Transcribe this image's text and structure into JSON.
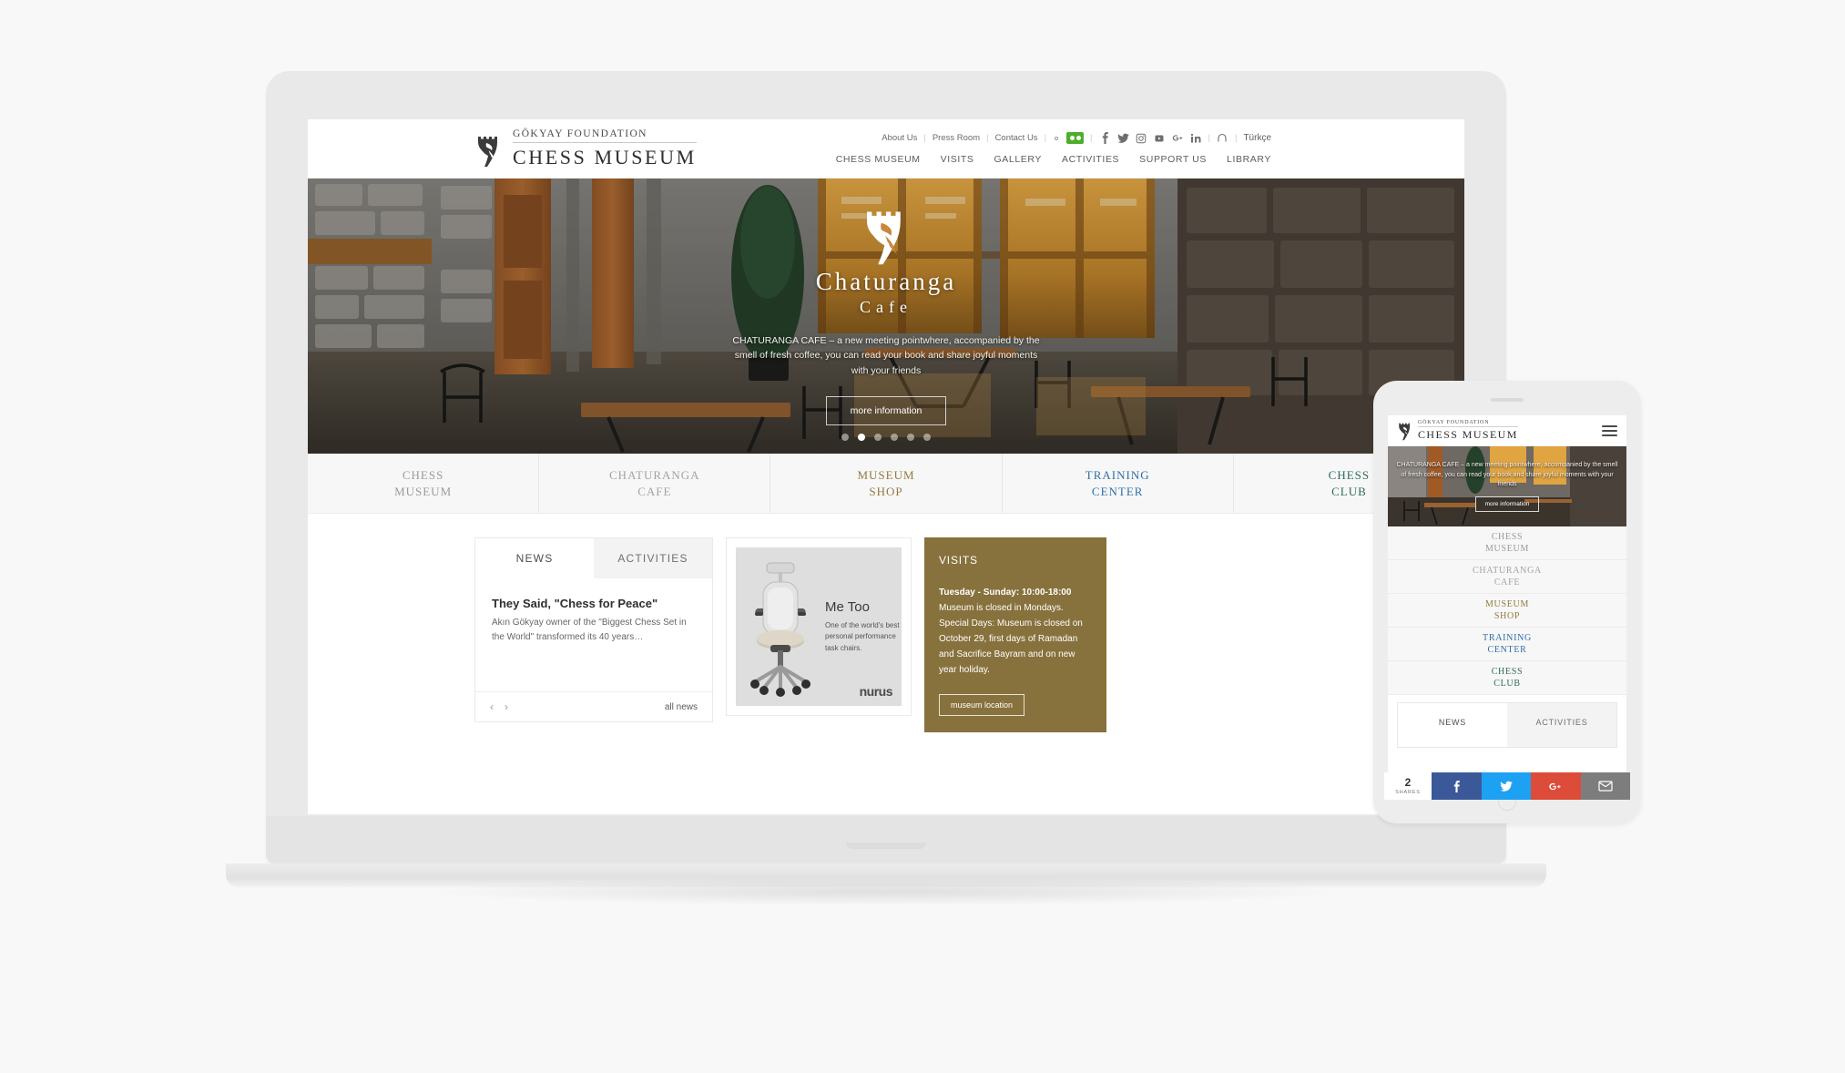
{
  "brand": {
    "foundation": "GÖKYAY FOUNDATION",
    "name": "CHESS MUSEUM"
  },
  "utility_nav": {
    "links": [
      "About Us",
      "Press Room",
      "Contact Us"
    ],
    "separator": "|",
    "social": [
      "search-icon",
      "tripadvisor-icon",
      "facebook-icon",
      "twitter-icon",
      "instagram-icon",
      "youtube-icon",
      "googleplus-icon",
      "linkedin-icon",
      "pinterest-icon"
    ],
    "language": "Türkçe"
  },
  "main_nav": {
    "items": [
      "CHESS MUSEUM",
      "VISITS",
      "GALLERY",
      "ACTIVITIES",
      "SUPPORT US",
      "LIBRARY"
    ]
  },
  "hero": {
    "title": "Chaturanga",
    "subtitle": "Cafe",
    "description": "CHATURANGA CAFE – a new meeting pointwhere, accompanied by the smell of fresh coffee, you can read your book and share joyful moments with your friends",
    "button": "more information",
    "slide_count": 6,
    "active_slide": 2
  },
  "categories": [
    {
      "line1": "CHESS",
      "line2": "MUSEUM",
      "color": "#9a9a9a"
    },
    {
      "line1": "CHATURANGA",
      "line2": "CAFE",
      "color": "#a3a3a3"
    },
    {
      "line1": "MUSEUM",
      "line2": "SHOP",
      "color": "#94793e"
    },
    {
      "line1": "TRAINING",
      "line2": "CENTER",
      "color": "#2f6fa8"
    },
    {
      "line1": "CHESS",
      "line2": "CLUB",
      "color": "#2e6b5e"
    }
  ],
  "news_panel": {
    "tabs": [
      {
        "label": "NEWS",
        "active": true
      },
      {
        "label": "ACTIVITIES",
        "active": false
      }
    ],
    "headline": "They Said, \"Chess for Peace\"",
    "excerpt": "Akın Gökyay owner of the \"Biggest Chess Set in the World\" transformed its 40 years…",
    "prev_arrow": "‹",
    "next_arrow": "›",
    "all_news": "all news"
  },
  "ad_panel": {
    "headline": "Me Too",
    "copy": "One of the world's best personal performance task chairs.",
    "brand": "nurus"
  },
  "visits_panel": {
    "title": "VISITS",
    "hours": "Tuesday - Sunday: 10:00-18:00",
    "note": "Museum is closed in Mondays. Special Days: Museum is closed on October 29, first days of Ramadan and Sacrifice Bayram and on new year holiday.",
    "button": "museum location",
    "background": "#87723d"
  },
  "mobile": {
    "brand_foundation": "GÖKYAY FOUNDATION",
    "brand_name": "CHESS MUSEUM",
    "menu_icon": "hamburger-menu-icon",
    "hero_description": "CHATURANGA CAFE – a new meeting pointwhere, accompanied by the smell of fresh coffee, you can read your book and share joyful moments with your friends",
    "hero_button": "more information",
    "categories": [
      {
        "line1": "CHESS",
        "line2": "MUSEUM",
        "color": "#9a9a9a"
      },
      {
        "line1": "CHATURANGA",
        "line2": "CAFE",
        "color": "#a3a3a3"
      },
      {
        "line1": "MUSEUM",
        "line2": "SHOP",
        "color": "#94793e"
      },
      {
        "line1": "TRAINING",
        "line2": "CENTER",
        "color": "#2f6fa8"
      },
      {
        "line1": "CHESS",
        "line2": "CLUB",
        "color": "#2e6b5e"
      }
    ],
    "tabs": [
      {
        "label": "NEWS",
        "active": true
      },
      {
        "label": "ACTIVITIES",
        "active": false
      }
    ]
  },
  "share_bar": {
    "count": "2",
    "count_label": "SHARES",
    "buttons": [
      {
        "icon": "facebook-icon",
        "color": "#3b5998"
      },
      {
        "icon": "twitter-icon",
        "color": "#1da1f2"
      },
      {
        "icon": "googleplus-icon",
        "color": "#dd4b39"
      },
      {
        "icon": "email-icon",
        "color": "#7d7d7d"
      }
    ]
  }
}
